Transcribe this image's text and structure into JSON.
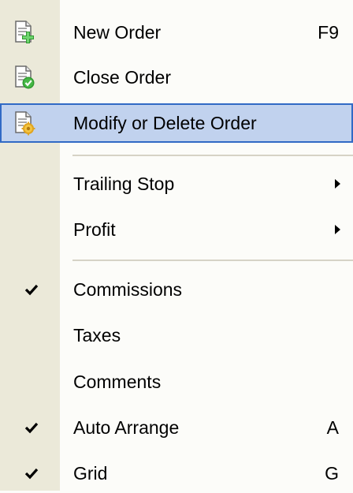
{
  "menu": {
    "items": [
      {
        "label": "New Order",
        "shortcut": "F9",
        "icon": "document-add-icon"
      },
      {
        "label": "Close Order",
        "icon": "document-check-icon"
      },
      {
        "label": "Modify or Delete Order",
        "icon": "document-gear-icon",
        "highlighted": true
      },
      {
        "label": "Trailing Stop",
        "submenu": true
      },
      {
        "label": "Profit",
        "submenu": true
      },
      {
        "label": "Commissions",
        "checked": true
      },
      {
        "label": "Taxes",
        "checked": false
      },
      {
        "label": "Comments",
        "checked": false
      },
      {
        "label": "Auto Arrange",
        "shortcut": "A",
        "checked": true
      },
      {
        "label": "Grid",
        "shortcut": "G",
        "checked": true
      }
    ]
  },
  "colors": {
    "gutter": "#ebe9d9",
    "menu_bg": "#fcfcf9",
    "highlight_bg": "#c1d2ee",
    "highlight_border": "#316ac5",
    "separator": "#d6d3c6"
  }
}
